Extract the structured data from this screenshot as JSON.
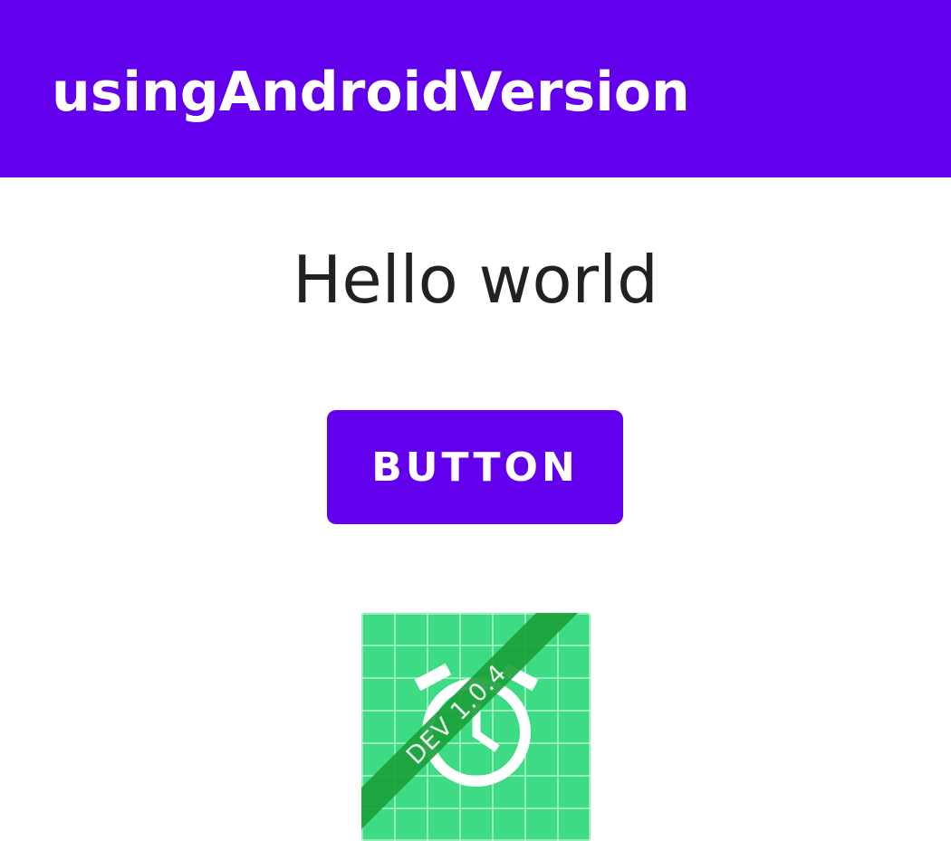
{
  "app_bar": {
    "title": "usingAndroidVersion",
    "background_color": "#6200EE"
  },
  "main": {
    "greeting": "Hello world",
    "button_label": "BUTTON",
    "button_color": "#6200EE"
  },
  "app_icon": {
    "icon": "stopwatch-icon",
    "badge_text": "DEV 1.0.4",
    "background_color": "#3DDC84",
    "banner_color": "#1A9E38"
  }
}
